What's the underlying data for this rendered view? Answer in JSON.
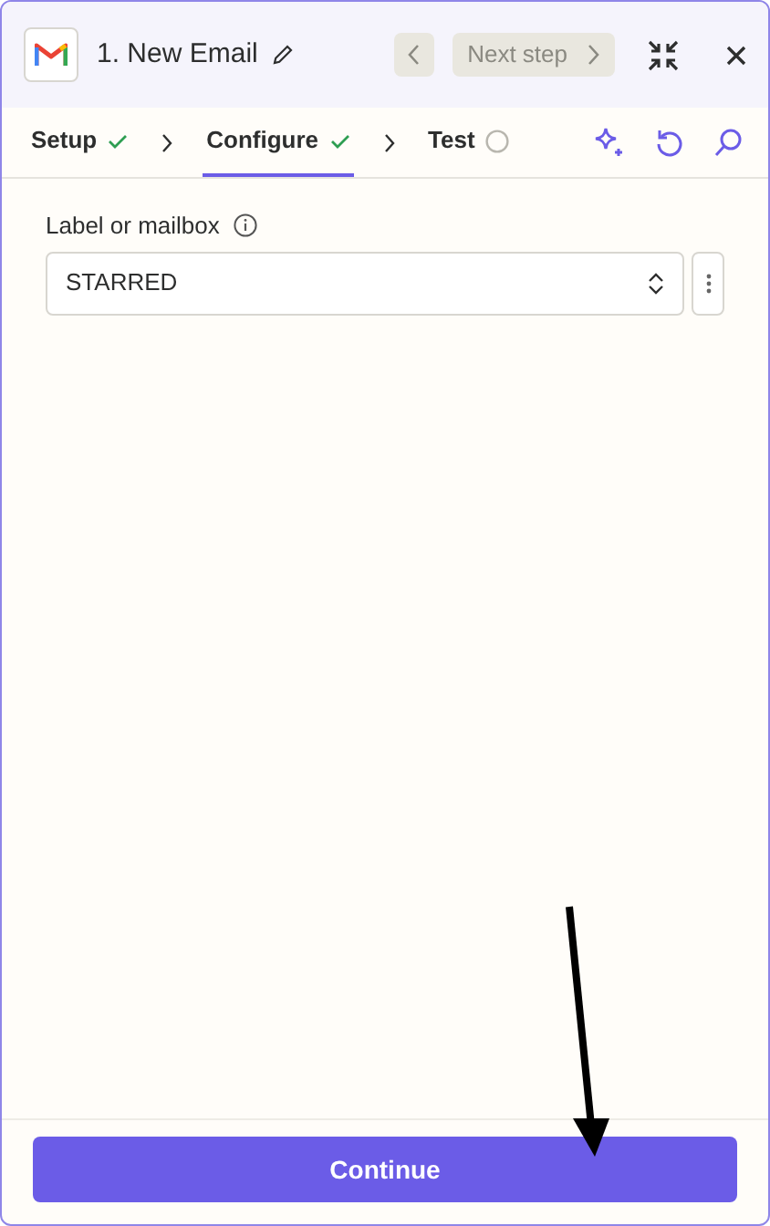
{
  "header": {
    "title": "1. New Email",
    "prev_disabled": true,
    "next": {
      "label": "Next step",
      "disabled": true
    }
  },
  "steps": [
    {
      "label": "Setup",
      "completed": true,
      "selected": false
    },
    {
      "label": "Configure",
      "completed": true,
      "selected": true
    },
    {
      "label": "Test",
      "completed": false,
      "selected": false
    }
  ],
  "field": {
    "label": "Label or mailbox",
    "value": "STARRED"
  },
  "footer": {
    "button": "Continue"
  }
}
